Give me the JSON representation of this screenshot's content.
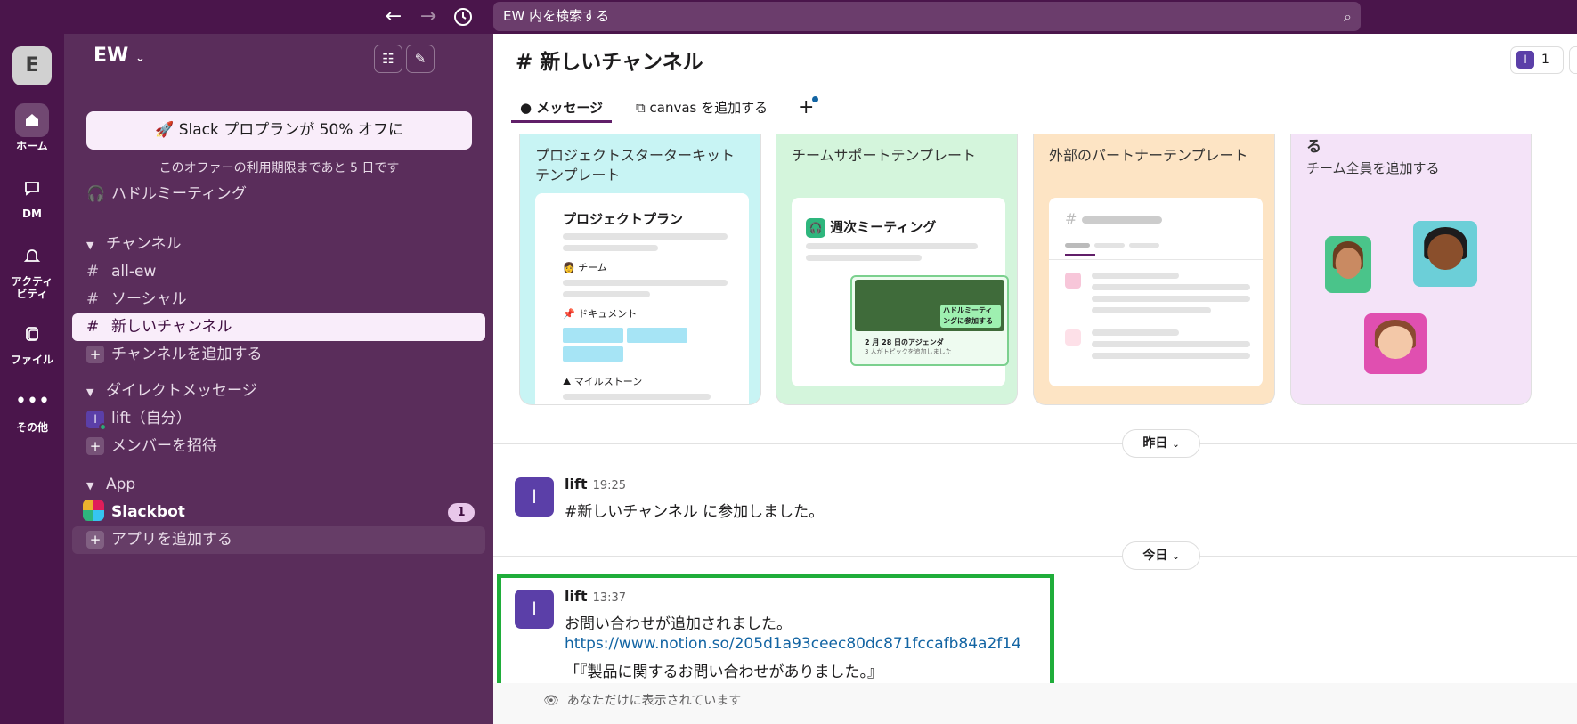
{
  "search": {
    "placeholder": "EW 内を検索する"
  },
  "rail": {
    "workspace_initial": "E",
    "items": [
      {
        "label": "ホーム"
      },
      {
        "label": "DM"
      },
      {
        "label": "アクティビティ"
      },
      {
        "label": "ファイル"
      },
      {
        "label": "その他"
      }
    ]
  },
  "sidebar": {
    "workspace_name": "EW",
    "promo_button": "Slack プロプランが 50% オフに",
    "promo_note": "このオファーの利用期限まであと 5 日です",
    "huddles": "ハドルミーティング",
    "channels_header": "チャンネル",
    "channels": [
      "all-ew",
      "ソーシャル",
      "新しいチャンネル"
    ],
    "add_channel": "チャンネルを追加する",
    "dm_header": "ダイレクトメッセージ",
    "dm_self": "lift（自分）",
    "invite": "メンバーを招待",
    "app_header": "App",
    "slackbot": "Slackbot",
    "slackbot_count": "1",
    "add_app": "アプリを追加する"
  },
  "main": {
    "channel_title": "# 新しいチャンネル",
    "member_count": "1",
    "tabs": {
      "messages": "メッセージ",
      "canvas": "canvas を追加する",
      "plus": "+"
    },
    "templates": [
      {
        "title": "プロジェクトスターターキット テンプレート",
        "doc_title": "プロジェクトプラン",
        "labels": [
          "チーム",
          "ドキュメント",
          "マイルストーン"
        ]
      },
      {
        "title": "チームサポートテンプレート",
        "doc_title": "週次ミーティング",
        "huddle_badge": "ハドルミーティングに参加する",
        "agenda": "2 月 28 日のアジェンダ",
        "agenda_sub": "3 人がトピックを追加しました"
      },
      {
        "title": "外部のパートナーテンプレート"
      },
      {
        "title": "る",
        "subtitle": "チーム全員を追加する"
      }
    ],
    "day_yesterday": "昨日",
    "day_today": "今日",
    "messages": [
      {
        "avatar": "l",
        "name": "lift",
        "time": "19:25",
        "text": "#新しいチャンネル に参加しました。"
      },
      {
        "avatar": "l",
        "name": "lift",
        "time": "13:37",
        "text": "お問い合わせが追加されました。",
        "link": "https://www.notion.so/205d1a93ceec80dc871fccafb84a2f14",
        "quote": "「『製品に関するお問い合わせがありました。』"
      }
    ],
    "ephemeral_note": "あなただけに表示されています"
  },
  "colors": {
    "aubergine": "#4a154b",
    "sidebar": "#5a2d5b",
    "link": "#1264a3",
    "highlight": "#1fad3a"
  }
}
